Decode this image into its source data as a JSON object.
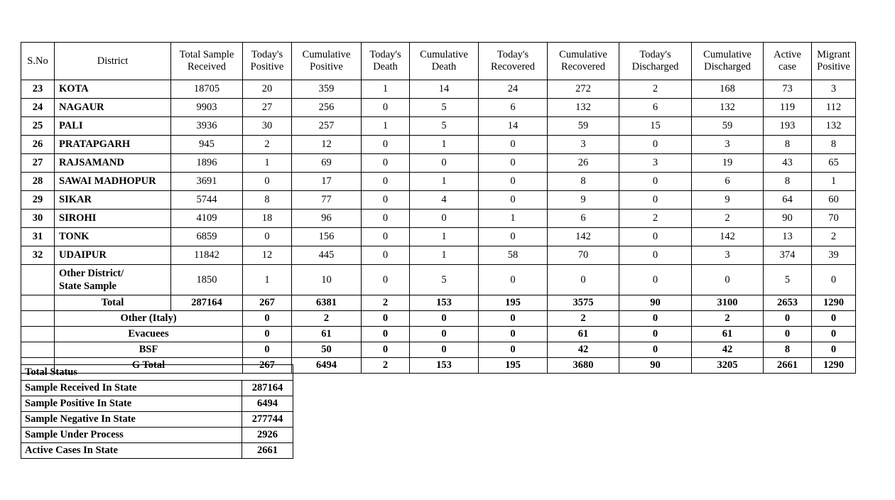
{
  "main_table": {
    "columns": [
      {
        "key": "sno",
        "label": "S.No"
      },
      {
        "key": "district",
        "label": "District"
      },
      {
        "key": "tsr",
        "label": "Total Sample\nReceived"
      },
      {
        "key": "tp",
        "label": "Today's\nPositive"
      },
      {
        "key": "cp",
        "label": "Cumulative\nPositive"
      },
      {
        "key": "td",
        "label": "Today's\nDeath"
      },
      {
        "key": "cd",
        "label": "Cumulative\nDeath"
      },
      {
        "key": "tr",
        "label": "Today's\nRecovered"
      },
      {
        "key": "cr",
        "label": "Cumulative\nRecovered"
      },
      {
        "key": "tdis",
        "label": "Today's\nDischarged"
      },
      {
        "key": "cdis",
        "label": "Cumulative\nDischarged"
      },
      {
        "key": "active",
        "label": "Active  case"
      },
      {
        "key": "migrant",
        "label": "Migrant\nPositive"
      }
    ],
    "rows": [
      {
        "sno": "23",
        "district": "KOTA",
        "tsr": "18705",
        "tp": "20",
        "cp": "359",
        "td": "1",
        "cd": "14",
        "tr": "24",
        "cr": "272",
        "tdis": "2",
        "cdis": "168",
        "active": "73",
        "migrant": "3"
      },
      {
        "sno": "24",
        "district": "NAGAUR",
        "tsr": "9903",
        "tp": "27",
        "cp": "256",
        "td": "0",
        "cd": "5",
        "tr": "6",
        "cr": "132",
        "tdis": "6",
        "cdis": "132",
        "active": "119",
        "migrant": "112"
      },
      {
        "sno": "25",
        "district": "PALI",
        "tsr": "3936",
        "tp": "30",
        "cp": "257",
        "td": "1",
        "cd": "5",
        "tr": "14",
        "cr": "59",
        "tdis": "15",
        "cdis": "59",
        "active": "193",
        "migrant": "132"
      },
      {
        "sno": "26",
        "district": "PRATAPGARH",
        "tsr": "945",
        "tp": "2",
        "cp": "12",
        "td": "0",
        "cd": "1",
        "tr": "0",
        "cr": "3",
        "tdis": "0",
        "cdis": "3",
        "active": "8",
        "migrant": "8"
      },
      {
        "sno": "27",
        "district": "RAJSAMAND",
        "tsr": "1896",
        "tp": "1",
        "cp": "69",
        "td": "0",
        "cd": "0",
        "tr": "0",
        "cr": "26",
        "tdis": "3",
        "cdis": "19",
        "active": "43",
        "migrant": "65"
      },
      {
        "sno": "28",
        "district": "SAWAI MADHOPUR",
        "tsr": "3691",
        "tp": "0",
        "cp": "17",
        "td": "0",
        "cd": "1",
        "tr": "0",
        "cr": "8",
        "tdis": "0",
        "cdis": "6",
        "active": "8",
        "migrant": "1"
      },
      {
        "sno": "29",
        "district": "SIKAR",
        "tsr": "5744",
        "tp": "8",
        "cp": "77",
        "td": "0",
        "cd": "4",
        "tr": "0",
        "cr": "9",
        "tdis": "0",
        "cdis": "9",
        "active": "64",
        "migrant": "60"
      },
      {
        "sno": "30",
        "district": "SIROHI",
        "tsr": "4109",
        "tp": "18",
        "cp": "96",
        "td": "0",
        "cd": "0",
        "tr": "1",
        "cr": "6",
        "tdis": "2",
        "cdis": "2",
        "active": "90",
        "migrant": "70"
      },
      {
        "sno": "31",
        "district": "TONK",
        "tsr": "6859",
        "tp": "0",
        "cp": "156",
        "td": "0",
        "cd": "1",
        "tr": "0",
        "cr": "142",
        "tdis": "0",
        "cdis": "142",
        "active": "13",
        "migrant": "2"
      },
      {
        "sno": "32",
        "district": "UDAIPUR",
        "tsr": "11842",
        "tp": "12",
        "cp": "445",
        "td": "0",
        "cd": "1",
        "tr": "58",
        "cr": "70",
        "tdis": "0",
        "cdis": "3",
        "active": "374",
        "migrant": "39"
      }
    ],
    "other_district_row": {
      "sno": "",
      "district": "Other District/\nState Sample",
      "tsr": "1850",
      "tp": "1",
      "cp": "10",
      "td": "0",
      "cd": "5",
      "tr": "0",
      "cr": "0",
      "tdis": "0",
      "cdis": "0",
      "active": "5",
      "migrant": "0"
    },
    "total_row": {
      "label": "Total",
      "tsr": "287164",
      "tp": "267",
      "cp": "6381",
      "td": "2",
      "cd": "153",
      "tr": "195",
      "cr": "3575",
      "tdis": "90",
      "cdis": "3100",
      "active": "2653",
      "migrant": "1290"
    },
    "extra_rows": [
      {
        "label": "Other (Italy)",
        "tp": "0",
        "cp": "2",
        "td": "0",
        "cd": "0",
        "tr": "0",
        "cr": "2",
        "tdis": "0",
        "cdis": "2",
        "active": "0",
        "migrant": "0"
      },
      {
        "label": "Evacuees",
        "tp": "0",
        "cp": "61",
        "td": "0",
        "cd": "0",
        "tr": "0",
        "cr": "61",
        "tdis": "0",
        "cdis": "61",
        "active": "0",
        "migrant": "0"
      },
      {
        "label": "BSF",
        "tp": "0",
        "cp": "50",
        "td": "0",
        "cd": "0",
        "tr": "0",
        "cr": "42",
        "tdis": "0",
        "cdis": "42",
        "active": "8",
        "migrant": "0"
      },
      {
        "label": "G Total",
        "tp": "267",
        "cp": "6494",
        "td": "2",
        "cd": "153",
        "tr": "195",
        "cr": "3680",
        "tdis": "90",
        "cdis": "3205",
        "active": "2661",
        "migrant": "1290"
      }
    ]
  },
  "status_table": {
    "title": "Total Status",
    "rows": [
      {
        "label": "Sample Received In State",
        "value": "287164"
      },
      {
        "label": "Sample Positive In State",
        "value": "6494"
      },
      {
        "label": "Sample Negative In State",
        "value": "277744"
      },
      {
        "label": "Sample Under Process",
        "value": "2926"
      },
      {
        "label": "Active Cases In State",
        "value": "2661"
      }
    ]
  }
}
